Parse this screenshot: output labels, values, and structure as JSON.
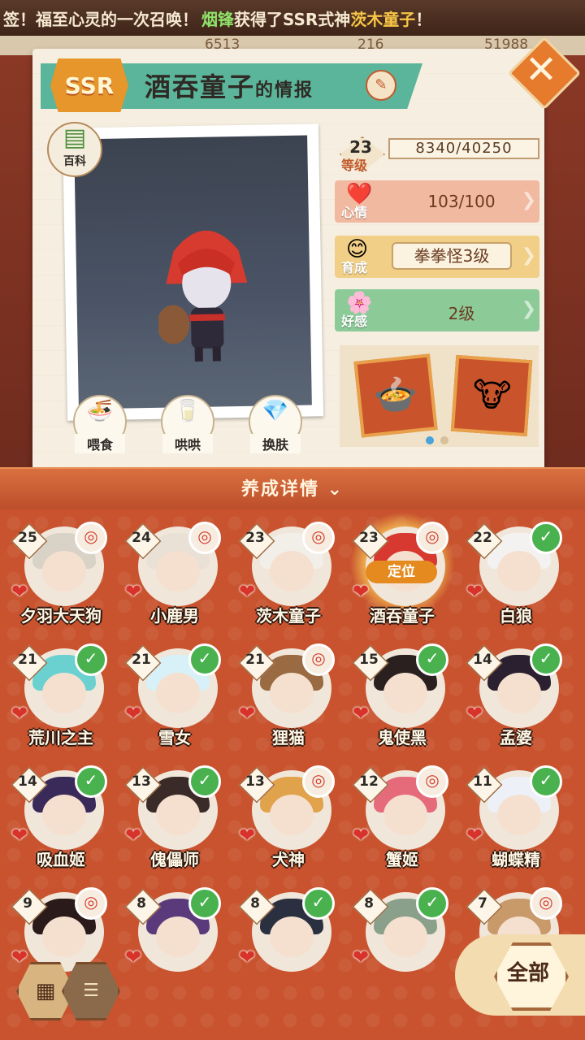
{
  "ticker": {
    "pre": "签！福至心灵的一次召唤！",
    "player": "烟锋",
    "mid": "获得了SSR式神",
    "shikigami": "茨木童子",
    "post": "！"
  },
  "top_values": [
    "6513",
    "216",
    "51988"
  ],
  "header": {
    "rarity": "SSR",
    "name": "酒吞童子",
    "suffix": "的情报",
    "close_label": "✕"
  },
  "baike_label": "百科",
  "actions": [
    {
      "label": "喂食",
      "icon": "bowl-icon"
    },
    {
      "label": "哄哄",
      "icon": "milk-icon"
    },
    {
      "label": "换肤",
      "icon": "gem-icon"
    }
  ],
  "stats": {
    "level": {
      "value": "23",
      "label": "等级",
      "exp": "8340/40250"
    },
    "mood": {
      "label": "心情",
      "value": "103/100"
    },
    "training": {
      "label": "育成",
      "value": "拳拳怪3级"
    },
    "affection": {
      "label": "好感",
      "value": "2级"
    }
  },
  "detail_bar": "养成详情",
  "shikigami": [
    {
      "name": "夕羽大天狗",
      "level": "25",
      "badge": "mark",
      "hair": "#d9d2c7"
    },
    {
      "name": "小鹿男",
      "level": "24",
      "badge": "mark",
      "hair": "#e9e1d6"
    },
    {
      "name": "茨木童子",
      "level": "23",
      "badge": "mark",
      "hair": "#f2efe9"
    },
    {
      "name": "酒吞童子",
      "level": "23",
      "badge": "mark",
      "hair": "#d7382f",
      "locate": "定位"
    },
    {
      "name": "白狼",
      "level": "22",
      "badge": "check",
      "hair": "#f4f2f0"
    },
    {
      "name": "荒川之主",
      "level": "21",
      "badge": "check",
      "hair": "#6ad0d0"
    },
    {
      "name": "雪女",
      "level": "21",
      "badge": "check",
      "hair": "#d8f0f8"
    },
    {
      "name": "狸猫",
      "level": "21",
      "badge": "mark",
      "hair": "#9a6a42"
    },
    {
      "name": "鬼使黑",
      "level": "15",
      "badge": "check",
      "hair": "#2a2020"
    },
    {
      "name": "孟婆",
      "level": "14",
      "badge": "check",
      "hair": "#2a2030"
    },
    {
      "name": "吸血姬",
      "level": "14",
      "badge": "check",
      "hair": "#3a2a5a"
    },
    {
      "name": "傀儡师",
      "level": "13",
      "badge": "check",
      "hair": "#3a2a28"
    },
    {
      "name": "犬神",
      "level": "13",
      "badge": "mark",
      "hair": "#e0a24a"
    },
    {
      "name": "蟹姬",
      "level": "12",
      "badge": "mark",
      "hair": "#e56a7a"
    },
    {
      "name": "蝴蝶精",
      "level": "11",
      "badge": "check",
      "hair": "#eef0f8"
    },
    {
      "name": "",
      "level": "9",
      "badge": "mark",
      "hair": "#2a1a1a"
    },
    {
      "name": "",
      "level": "8",
      "badge": "check",
      "hair": "#5a3a7a"
    },
    {
      "name": "",
      "level": "8",
      "badge": "check",
      "hair": "#2a3040"
    },
    {
      "name": "",
      "level": "8",
      "badge": "check",
      "hair": "#8aa08a"
    },
    {
      "name": "",
      "level": "7",
      "badge": "mark",
      "hair": "#c89a6a"
    }
  ],
  "filter_label": "全部"
}
